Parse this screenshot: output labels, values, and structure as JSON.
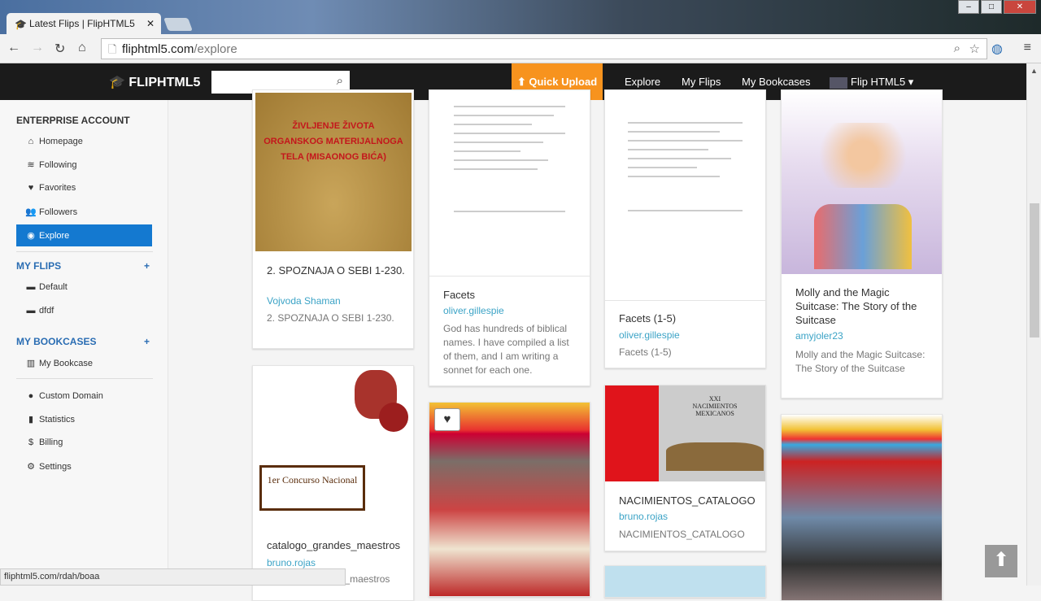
{
  "browser": {
    "tab_title": "Latest Flips | FlipHTML5",
    "url_host": "fliphtml5.com",
    "url_path": "/explore",
    "status_url": "fliphtml5.com/rdah/boaa"
  },
  "header": {
    "logo": "FLIPHTML5",
    "search_placeholder": "",
    "quick_upload": "Quick Upload",
    "nav": [
      "Explore",
      "My Flips",
      "My Bookcases"
    ],
    "user": "Flip HTML5"
  },
  "sidebar": {
    "account_heading": "ENTERPRISE ACCOUNT",
    "account_items": [
      {
        "label": "Homepage",
        "icon": "home-icon"
      },
      {
        "label": "Following",
        "icon": "rss-icon"
      },
      {
        "label": "Favorites",
        "icon": "heart-icon"
      },
      {
        "label": "Followers",
        "icon": "users-icon"
      },
      {
        "label": "Explore",
        "icon": "eye-icon",
        "active": true
      }
    ],
    "flips_heading": "MY FLIPS",
    "flips": [
      "Default",
      "dfdf"
    ],
    "bookcases_heading": "MY BOOKCASES",
    "bookcases": [
      "My Bookcase"
    ],
    "other": [
      "Custom Domain",
      "Statistics",
      "Billing",
      "Settings"
    ]
  },
  "cards": [
    {
      "title": "2. SPOZNAJA O SEBI 1-230.",
      "author": "Vojvoda Shaman",
      "desc": "2. SPOZNAJA O SEBI 1-230.",
      "cover_text": "ŽIVLJENJE ŽIVOTA ORGANSKOG MATERIJALNOGA TELA (MISAONOG BIĆA)"
    },
    {
      "title": "catalogo_grandes_maestros",
      "author": "bruno.rojas",
      "desc": "catalogo_grandes_maestros",
      "cover_text": "1er Concurso Nacional"
    },
    {
      "title": "Facets",
      "author": "oliver.gillespie",
      "desc": "God has hundreds of biblical names. I have compiled a list of them, and I am writing a sonnet for each one."
    },
    {
      "title": "Facets (1-5)",
      "author": "oliver.gillespie",
      "desc": "Facets (1-5)"
    },
    {
      "title": "NACIMIENTOS_CATALOGO",
      "author": "bruno.rojas",
      "desc": "NACIMIENTOS_CATALOGO",
      "cover_text": "XXI NACIMIENTOS MEXICANOS"
    },
    {
      "title": "Molly and the Magic Suitcase: The Story of the Suitcase",
      "author": "amyjoler23",
      "desc": "Molly and the Magic Suitcase: The Story of the Suitcase"
    }
  ],
  "colors": {
    "accent": "#1479d0",
    "upload": "#f7931e",
    "link": "#3ba3c6"
  }
}
